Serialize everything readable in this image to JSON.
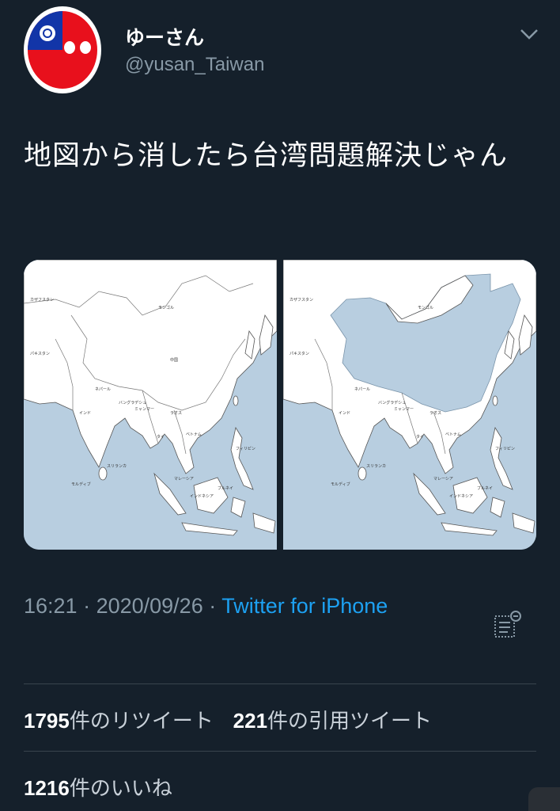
{
  "user": {
    "display_name": "ゆーさん",
    "handle": "@yusan_Taiwan",
    "avatar_icon": "taiwan-flag-ball-icon"
  },
  "tweet": {
    "text": "地図から消したら台湾問題解決じゃん"
  },
  "media": {
    "left_map": {
      "labels": [
        "カザフスタン",
        "モンゴル",
        "中国",
        "インド",
        "ミャンマー",
        "タイ",
        "ベトナム",
        "フィリピン",
        "インドネシア",
        "マレーシア",
        "スリランカ",
        "モルディブ",
        "ネパール",
        "バングラデシュ",
        "パキスタン",
        "ブルネイ",
        "ラオス"
      ]
    },
    "right_map": {
      "labels": [
        "カザフスタン",
        "モンゴル",
        "インド",
        "ミャンマー",
        "タイ",
        "ベトナム",
        "フィリピン",
        "インドネシア",
        "マレーシア",
        "スリランカ",
        "モルディブ",
        "ネパール",
        "バングラデシュ",
        "パキスタン",
        "ブルネイ",
        "ラオス"
      ]
    }
  },
  "meta": {
    "time": "16:21",
    "separator": " · ",
    "date": "2020/09/26",
    "source": "Twitter for iPhone",
    "analytics_icon": "analytics-icon"
  },
  "stats": {
    "retweet_count": "1795",
    "retweet_label": "件のリツイート",
    "quote_count": "221",
    "quote_label": "件の引用ツイート",
    "like_count": "1216",
    "like_label": "件のいいね"
  },
  "colors": {
    "background": "#15202b",
    "link": "#1da1f2",
    "muted": "#8899a6",
    "sea": "#b8cee0"
  }
}
